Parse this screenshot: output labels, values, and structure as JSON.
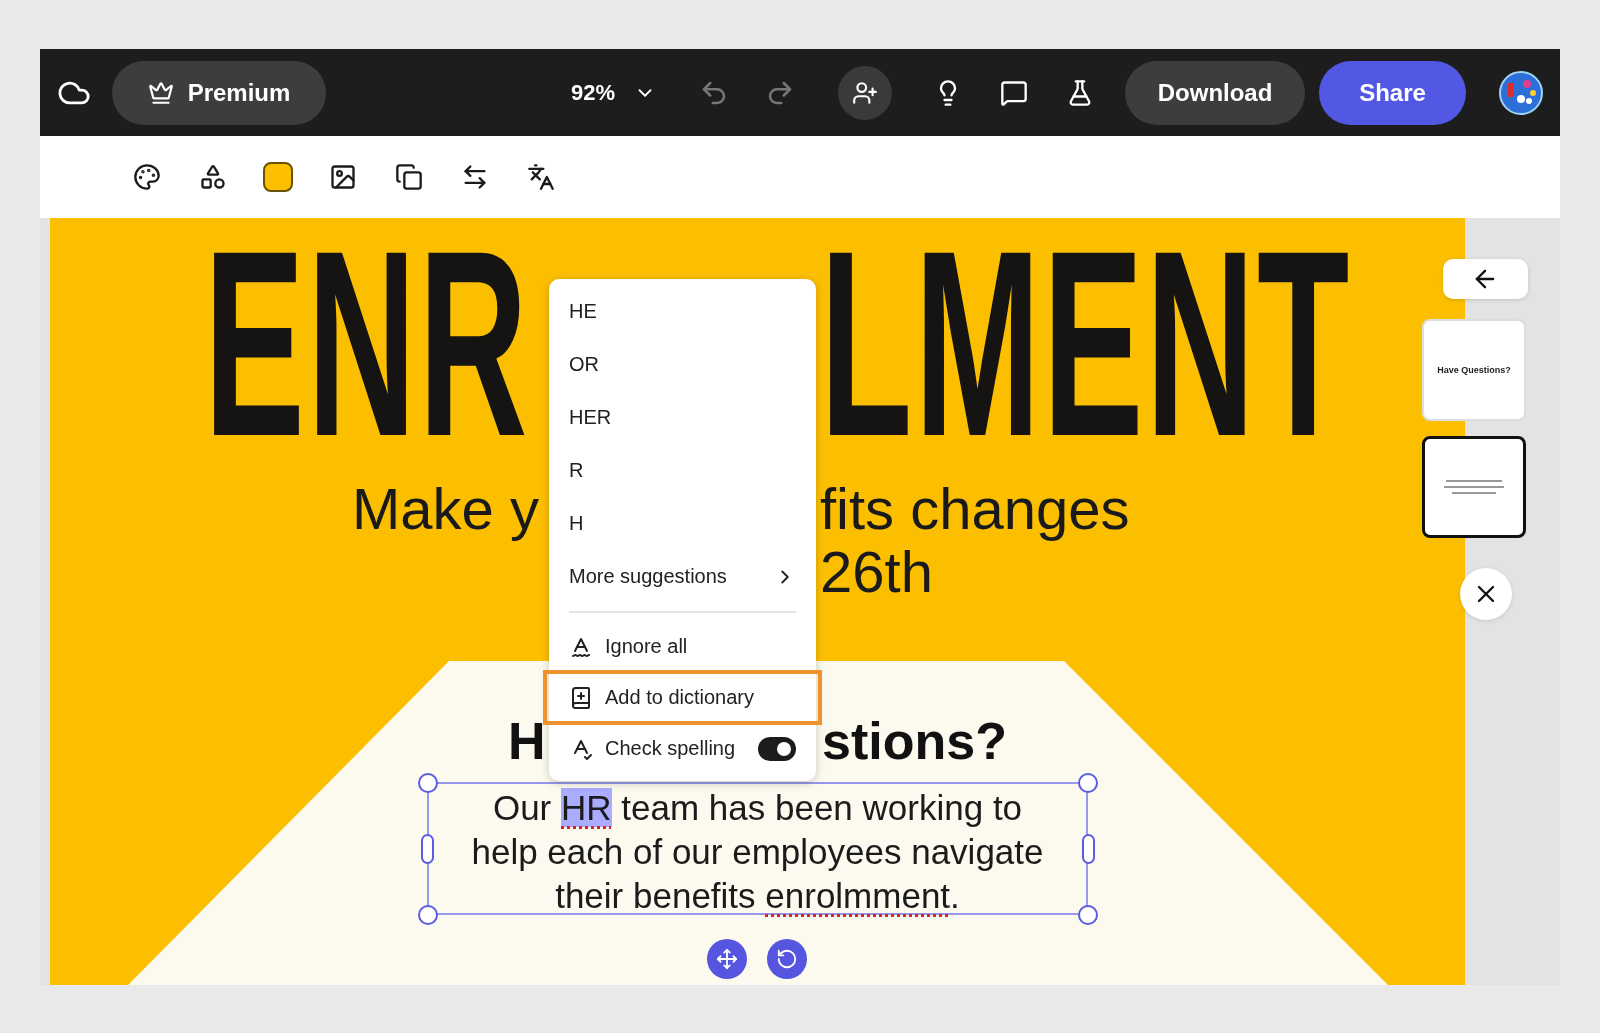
{
  "top_bar": {
    "premium": {
      "label": "Premium"
    },
    "zoom": {
      "value": "92%"
    },
    "undo": {
      "disabled": true
    },
    "redo": {
      "disabled": true
    },
    "download": {
      "label": "Download"
    },
    "share": {
      "label": "Share"
    }
  },
  "tools": [
    {
      "kind": "palette"
    },
    {
      "kind": "shapes"
    },
    {
      "kind": "swatch"
    },
    {
      "kind": "frame"
    },
    {
      "kind": "layers"
    },
    {
      "kind": "swap"
    },
    {
      "kind": "translate"
    }
  ],
  "slide": {
    "title_left": "ENR",
    "title_right": "LMENT",
    "subtitle_left": "Make y",
    "subtitle_right": "fits changes",
    "subtitle_line2": "26th",
    "heading_left": "H",
    "heading_right": "stions?",
    "body": {
      "lines": [
        [
          {
            "text": "Our "
          },
          {
            "text": "HR",
            "misspelled": true,
            "selected": true
          },
          {
            "text": " team has been working to"
          }
        ],
        [
          {
            "text": "help each of our employees navigate"
          }
        ],
        [
          {
            "text": "their benefits "
          },
          {
            "text": "enrolmment",
            "misspelled": true,
            "selected": false
          },
          {
            "text": "."
          }
        ]
      ]
    }
  },
  "context_menu": {
    "suggestions": [
      {
        "label": "HE"
      },
      {
        "label": "OR"
      },
      {
        "label": "HER"
      },
      {
        "label": "R"
      },
      {
        "label": "H"
      }
    ],
    "more": {
      "label": "More suggestions"
    },
    "actions": [
      {
        "kind": "ignore",
        "label": "Ignore all",
        "highlighted": false
      },
      {
        "kind": "add",
        "label": "Add to dictionary",
        "highlighted": true
      }
    ],
    "check_spelling": {
      "label": "Check spelling",
      "on": true
    }
  },
  "pages": [
    {
      "kind": "title",
      "title": "Have Questions?",
      "selected": false
    },
    {
      "kind": "lines",
      "selected": true
    }
  ]
}
